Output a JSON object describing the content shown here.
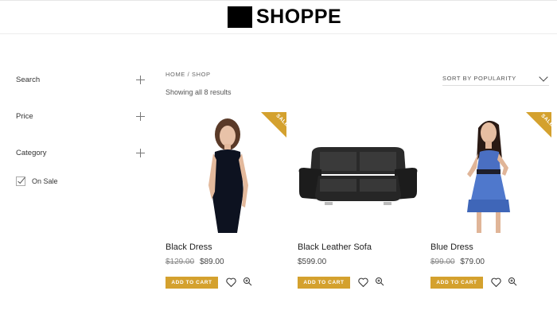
{
  "header": {
    "logo_text": "SHOPPE"
  },
  "sidebar": {
    "filters": [
      {
        "label": "Search"
      },
      {
        "label": "Price"
      },
      {
        "label": "Category"
      }
    ],
    "on_sale": {
      "label": "On Sale",
      "checked": true
    }
  },
  "main": {
    "breadcrumb": {
      "home": "HOME",
      "separator": "/",
      "current": "SHOP"
    },
    "results_text": "Showing all 8 results",
    "sort_label": "SORT BY POPULARITY"
  },
  "products": [
    {
      "name": "Black Dress",
      "old_price": "$129.00",
      "price": "$89.00",
      "sale_badge": "SALE",
      "add_to_cart": "ADD TO CART"
    },
    {
      "name": "Black Leather Sofa",
      "old_price": "",
      "price": "$599.00",
      "sale_badge": "",
      "add_to_cart": "ADD TO CART"
    },
    {
      "name": "Blue Dress",
      "old_price": "$99.00",
      "price": "$79.00",
      "sale_badge": "SALE",
      "add_to_cart": "ADD TO CART"
    }
  ],
  "colors": {
    "accent": "#d4a12e",
    "text": "#333333"
  }
}
